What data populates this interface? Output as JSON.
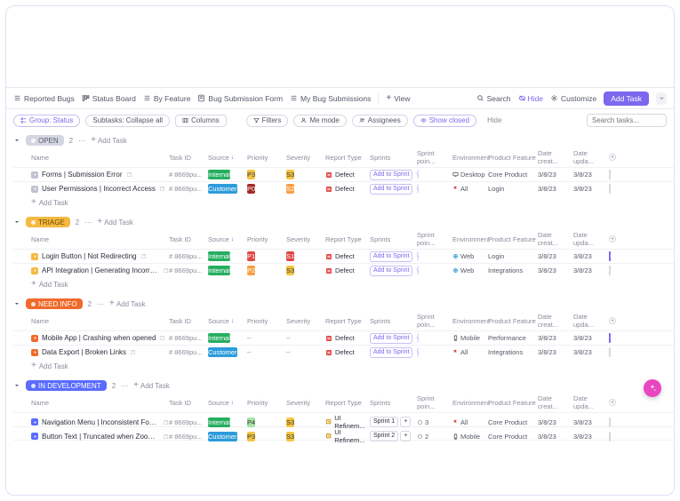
{
  "viewTabs": {
    "reported": "Reported Bugs",
    "status": "Status Board",
    "feature": "By Feature",
    "form": "Bug Submission Form",
    "my": "My Bug Submissions",
    "addView": "View"
  },
  "topRight": {
    "search": "Search",
    "hide": "Hide",
    "customize": "Customize",
    "addTask": "Add Task"
  },
  "filters": {
    "group": "Group: Status",
    "subtasks": "Subtasks: Collapse all",
    "columns": "Columns",
    "filters": "Filters",
    "me": "Me mode",
    "assignees": "Assignees",
    "showClosed": "Show closed",
    "hideLabel": "Hide"
  },
  "searchPlaceholder": "Search tasks...",
  "columns": {
    "name": "Name",
    "taskId": "Task ID",
    "source": "Source",
    "priority": "Priority",
    "severity": "Severity",
    "reportType": "Report Type",
    "sprints": "Sprints",
    "sprintPoints": "Sprint poin...",
    "environment": "Environment",
    "productFeature": "Product Feature",
    "dateCreated": "Date creat...",
    "dateUpdated": "Date upda..."
  },
  "addTaskLabel": "Add Task",
  "addToSprintLabel": "Add to Sprint",
  "groups": [
    {
      "name": "OPEN",
      "color": "#d3d6e0",
      "textColor": "#5a5d6e",
      "count": 2,
      "rows": [
        {
          "name": "Forms | Submission Error",
          "statusColor": "#bfc3d0",
          "id": "# 8669pu...",
          "source": "Internal",
          "pri": "P3",
          "sev": "S3",
          "rtype": "Defect",
          "rtypeKind": "defect",
          "sprint": "add",
          "env": "Desktop",
          "envIcon": "desktop",
          "feat": "Core Product",
          "created": "3/8/23",
          "updated": "3/8/23",
          "chk": false
        },
        {
          "name": "User Permissions | Incorrect Access",
          "statusColor": "#bfc3d0",
          "id": "# 8669pu...",
          "source": "Customer",
          "pri": "P0",
          "sev": "S2",
          "rtype": "Defect",
          "rtypeKind": "defect",
          "sprint": "add",
          "env": "All",
          "envIcon": "flag",
          "feat": "Login",
          "created": "3/8/23",
          "updated": "3/8/23",
          "chk": false
        }
      ]
    },
    {
      "name": "TRIAGE",
      "color": "#f5b942",
      "textColor": "#6b4b00",
      "count": 2,
      "rows": [
        {
          "name": "Login Button | Not Redirecting",
          "statusColor": "#f5b942",
          "id": "# 8669pu...",
          "source": "Internal",
          "pri": "P1",
          "sev": "S1",
          "rtype": "Defect",
          "rtypeKind": "defect",
          "sprint": "add",
          "env": "Web",
          "envIcon": "web",
          "feat": "Login",
          "created": "3/8/23",
          "updated": "3/8/23",
          "chk": true
        },
        {
          "name": "API Integration | Generating Incorrect ...",
          "statusColor": "#f5b942",
          "id": "# 8669pu...",
          "source": "Internal",
          "pri": "P2",
          "sev": "S3",
          "rtype": "Defect",
          "rtypeKind": "defect",
          "sprint": "add",
          "env": "Web",
          "envIcon": "web",
          "feat": "Integrations",
          "created": "3/8/23",
          "updated": "3/8/23",
          "chk": false
        }
      ]
    },
    {
      "name": "NEED INFO",
      "color": "#f06a2b",
      "textColor": "#fff",
      "count": 2,
      "rows": [
        {
          "name": "Mobile App | Crashing when opened",
          "statusColor": "#f06a2b",
          "id": "# 8669pu...",
          "source": "Internal",
          "pri": "–",
          "sev": "–",
          "rtype": "Defect",
          "rtypeKind": "defect",
          "sprint": "add",
          "env": "Mobile",
          "envIcon": "mobile",
          "feat": "Performance",
          "created": "3/8/23",
          "updated": "3/8/23",
          "chk": true
        },
        {
          "name": "Data Export | Broken Links",
          "statusColor": "#f06a2b",
          "id": "# 8669pu...",
          "source": "Customer",
          "pri": "–",
          "sev": "–",
          "rtype": "Defect",
          "rtypeKind": "defect",
          "sprint": "add",
          "env": "All",
          "envIcon": "flag",
          "feat": "Integrations",
          "created": "3/8/23",
          "updated": "3/8/23",
          "chk": false
        }
      ]
    },
    {
      "name": "IN DEVELOPMENT",
      "color": "#5a6cff",
      "textColor": "#fff",
      "count": 2,
      "rows": [
        {
          "name": "Navigation Menu | Inconsistent Font Si...",
          "statusColor": "#5a6cff",
          "id": "# 8669pu...",
          "source": "Internal",
          "pri": "P4",
          "sev": "S3",
          "rtype": "UI Refinem...",
          "rtypeKind": "ui",
          "sprint": "Sprint 1",
          "sprintPts": "3",
          "env": "All",
          "envIcon": "flag",
          "feat": "Core Product",
          "created": "3/8/23",
          "updated": "3/8/23",
          "chk": false
        },
        {
          "name": "Button Text | Truncated when Zoomed...",
          "statusColor": "#5a6cff",
          "id": "# 8669pu...",
          "source": "Customer",
          "pri": "P3",
          "sev": "S3",
          "rtype": "UI Refinem...",
          "rtypeKind": "ui",
          "sprint": "Sprint 2",
          "sprintPts": "2",
          "env": "Mobile",
          "envIcon": "mobile",
          "feat": "Core Product",
          "created": "3/8/23",
          "updated": "3/8/23",
          "chk": false
        }
      ]
    }
  ]
}
